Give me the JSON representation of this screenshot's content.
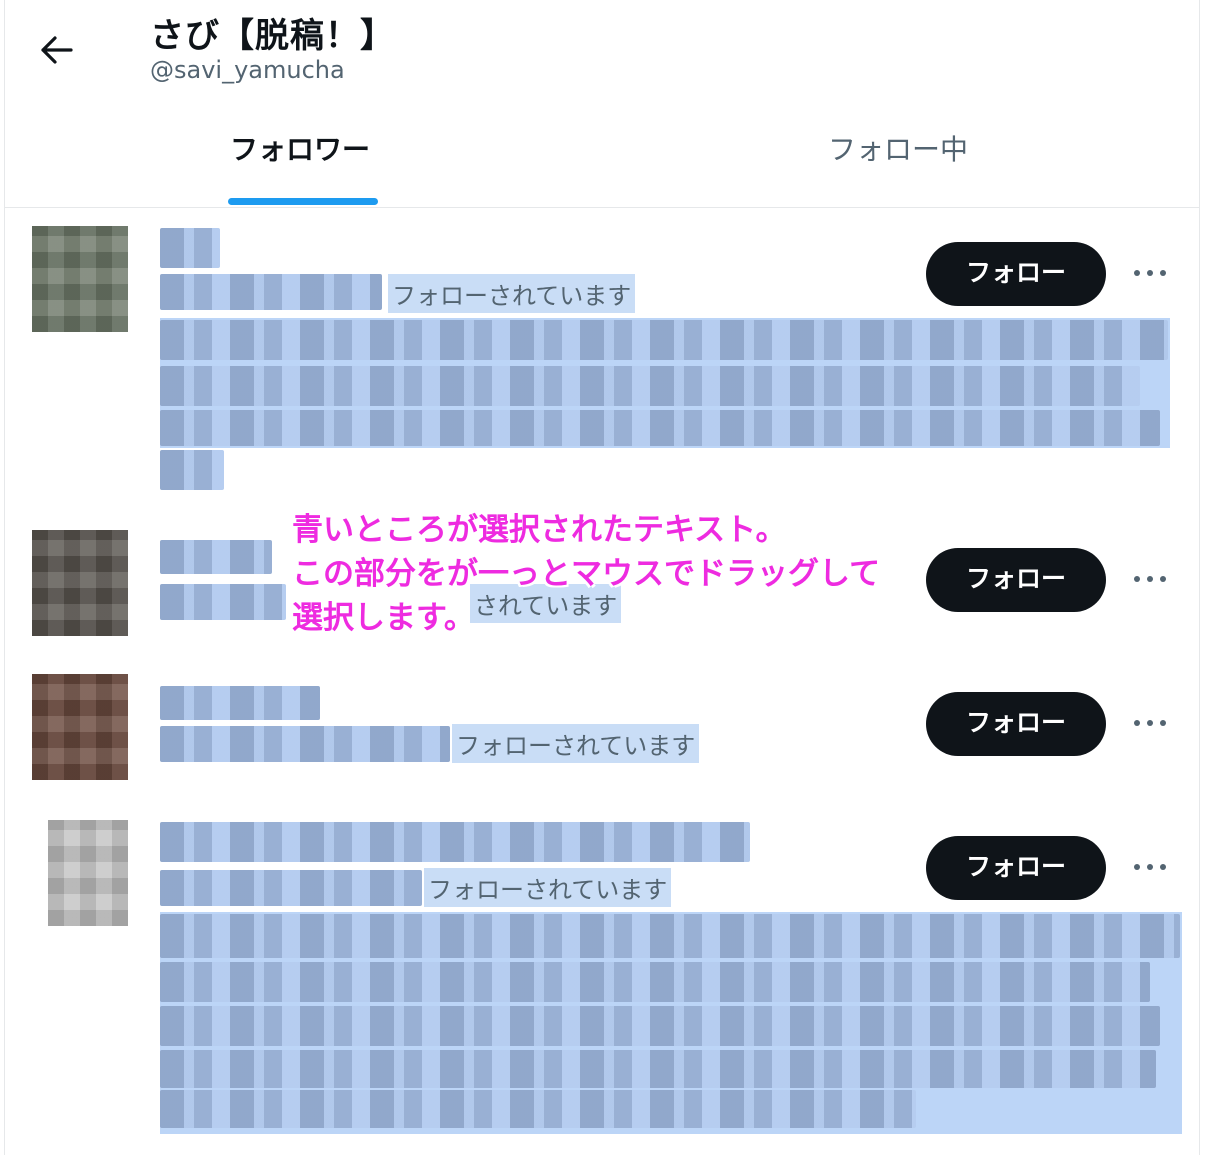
{
  "header": {
    "title": "さび【脱稿！】",
    "handle": "@savi_yamucha",
    "back_icon": "arrow-left-icon"
  },
  "tabs": [
    {
      "label": "フォロワー",
      "active": true
    },
    {
      "label": "フォロー中",
      "active": false
    }
  ],
  "users": [
    {
      "followed_label": "フォローされています",
      "button_label": "フォロー"
    },
    {
      "followed_label": "されています",
      "button_label": "フォロー"
    },
    {
      "followed_label": "フォローされています",
      "button_label": "フォロー"
    },
    {
      "followed_label": "フォローされています",
      "button_label": "フォロー"
    }
  ],
  "annotation": {
    "line1": "青いところが選択されたテキスト。",
    "line2": "この部分をが一っとマウスでドラッグして",
    "line3": "選択します。"
  },
  "colors": {
    "accent": "#1d9bf0",
    "selection": "#b7d3f7",
    "annotation": "#ee2be0",
    "button": "#0f1419"
  }
}
